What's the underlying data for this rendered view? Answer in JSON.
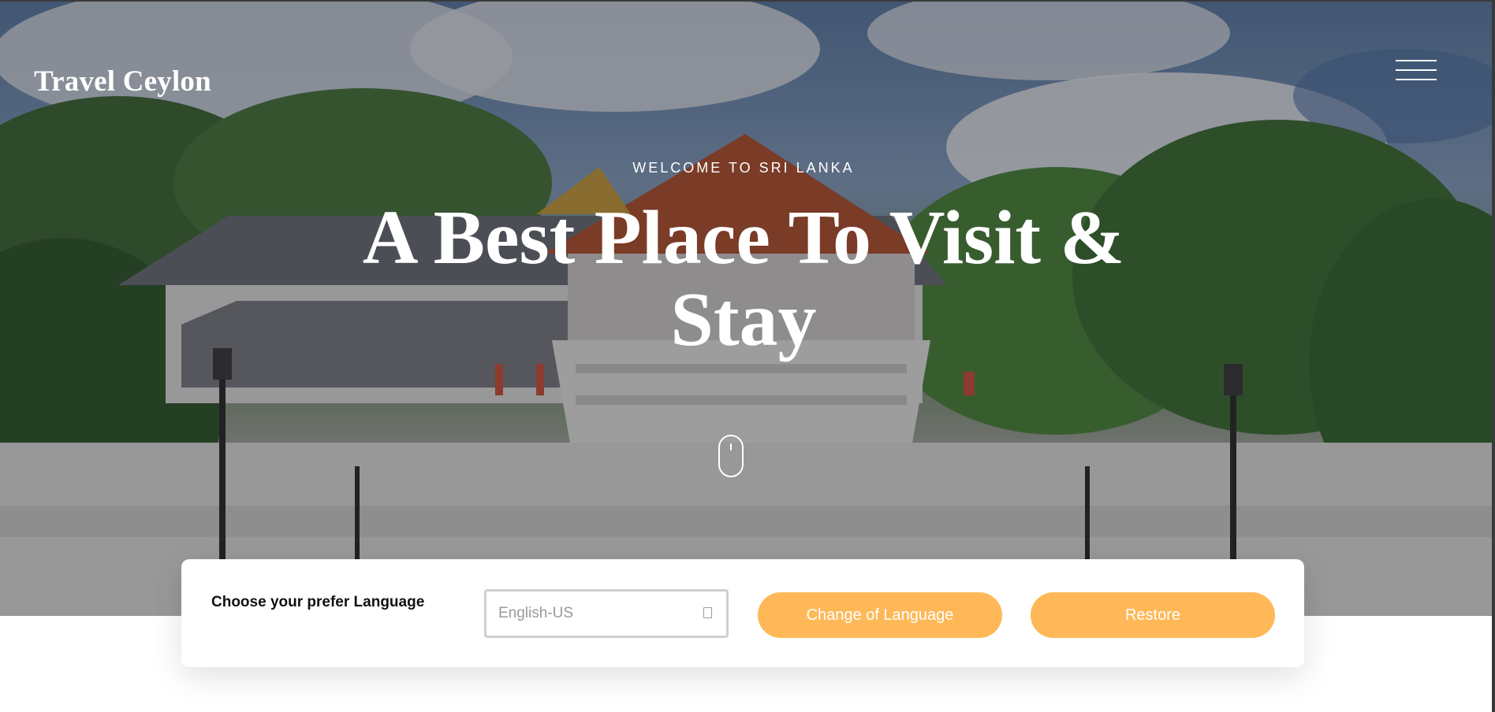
{
  "header": {
    "brand": "Travel Ceylon",
    "menu_icon": "hamburger-menu-icon"
  },
  "hero": {
    "kicker": "WELCOME TO SRI LANKA",
    "headline": "A Best Place To Visit & Stay",
    "scroll_icon": "mouse-scroll-icon"
  },
  "language_bar": {
    "label": "Choose your prefer Language",
    "selected_language": "English-US",
    "caret_icon": "dropdown-caret-icon",
    "change_button": "Change of Language",
    "restore_button": "Restore"
  },
  "colors": {
    "accent": "#ffb857",
    "overlay": "#14141c",
    "text_light": "#ffffff"
  }
}
